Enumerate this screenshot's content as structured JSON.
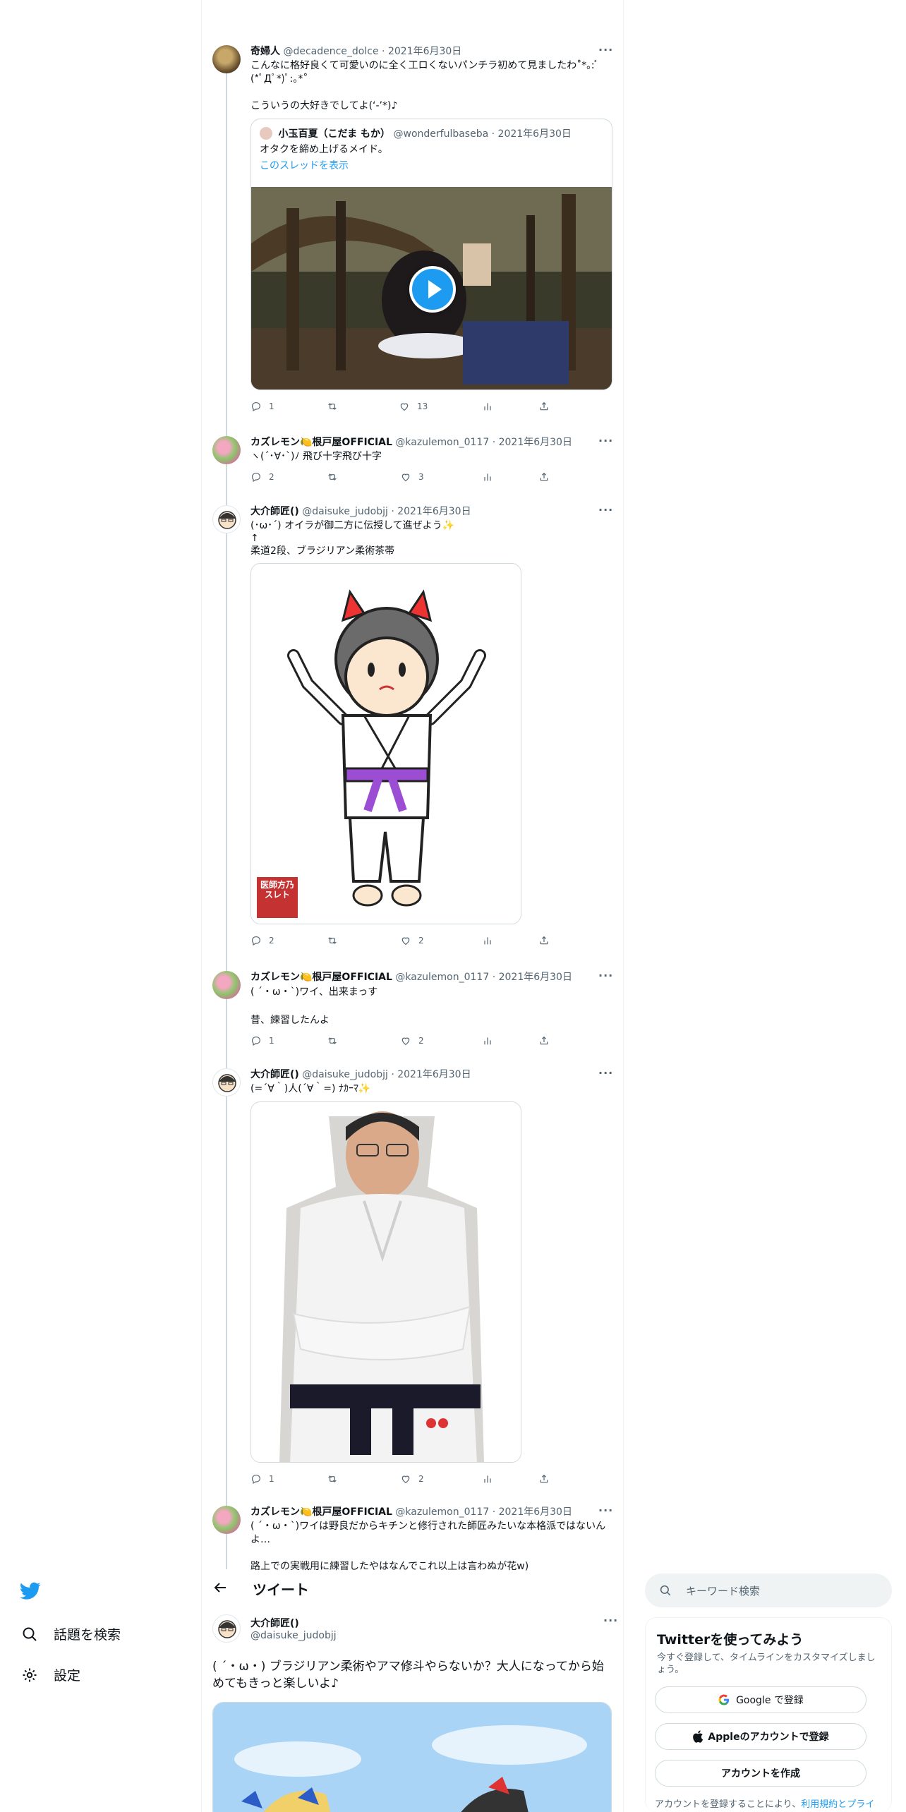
{
  "colors": {
    "accent": "#1d9bf0",
    "secondary_text": "#536471",
    "border": "#cfd9de"
  },
  "thread": [
    {
      "name": "奇婦人",
      "handle": "@decadence_dolce",
      "date": "2021年6月30日",
      "text": "こんなに格好良くて可愛いのに全く工ロくないパンチラ初めて見ましたわ˚*｡:ﾟ(*ﾟДﾟ*)ﾟ:｡*˚\n\nこういうの大好きでしてよ(‘-’*)♪",
      "quote": {
        "name": "小玉百夏（こだま もか）",
        "handle": "@wonderfulbaseba",
        "date": "2021年6月30日",
        "text": "オタクを締め上げるメイド。",
        "show_thread": "このスレッドを表示"
      },
      "replies": "1",
      "likes": "13"
    },
    {
      "name": "カズレモン🍋根戸屋OFFICIAL",
      "handle": "@kazulemon_0117",
      "date": "2021年6月30日",
      "text": "ヽ(´･∀･`)ﾉ 飛び十字飛び十字",
      "replies": "2",
      "likes": "3"
    },
    {
      "name": "大介師匠()",
      "handle": "@daisuke_judobjj",
      "date": "2021年6月30日",
      "text": "(･ω･´) オイラが御二方に伝授して進ぜよう✨\n↑\n柔道2段、ブラジリアン柔術茶帯",
      "stamp": "医師方乃スレト",
      "replies": "2",
      "likes": "2"
    },
    {
      "name": "カズレモン🍋根戸屋OFFICIAL",
      "handle": "@kazulemon_0117",
      "date": "2021年6月30日",
      "text": "( ´・ω・`)ワイ、出来まっす\n\n昔、練習したんよ",
      "replies": "1",
      "likes": "2"
    },
    {
      "name": "大介師匠()",
      "handle": "@daisuke_judobjj",
      "date": "2021年6月30日",
      "text": "(=´∀｀)人(´∀｀=) ﾅｶｰﾏ✨",
      "replies": "1",
      "likes": "2"
    },
    {
      "name": "カズレモン🍋根戸屋OFFICIAL",
      "handle": "@kazulemon_0117",
      "date": "2021年6月30日",
      "text": "( ´・ω・`)ワイは野良だからキチンと修行された師匠みたいな本格派ではないんよ…\n\n路上での実戦用に練習したやはなんでこれ以上は言わぬが花w)"
    }
  ],
  "sidebar": {
    "search_label": "話題を検索",
    "settings_label": "設定"
  },
  "header": {
    "title": "ツイート"
  },
  "main_tweet": {
    "name": "大介師匠()",
    "handle": "@daisuke_judobjj",
    "text": "( ´・ω・) ブラジリアン柔術やアマ修斗やらないか？大人になってから始めてもきっと楽しいよ♪"
  },
  "right": {
    "search_placeholder": "キーワード検索",
    "signup_title": "Twitterを使ってみよう",
    "signup_desc": "今すぐ登録して、タイムラインをカスタマイズしましょう。",
    "google_btn": "Google で登録",
    "apple_btn": "Appleのアカウントで登録",
    "create_btn": "アカウントを作成",
    "terms_prefix": "アカウントを登録することにより、",
    "terms_link": "利用規約とプライ"
  }
}
